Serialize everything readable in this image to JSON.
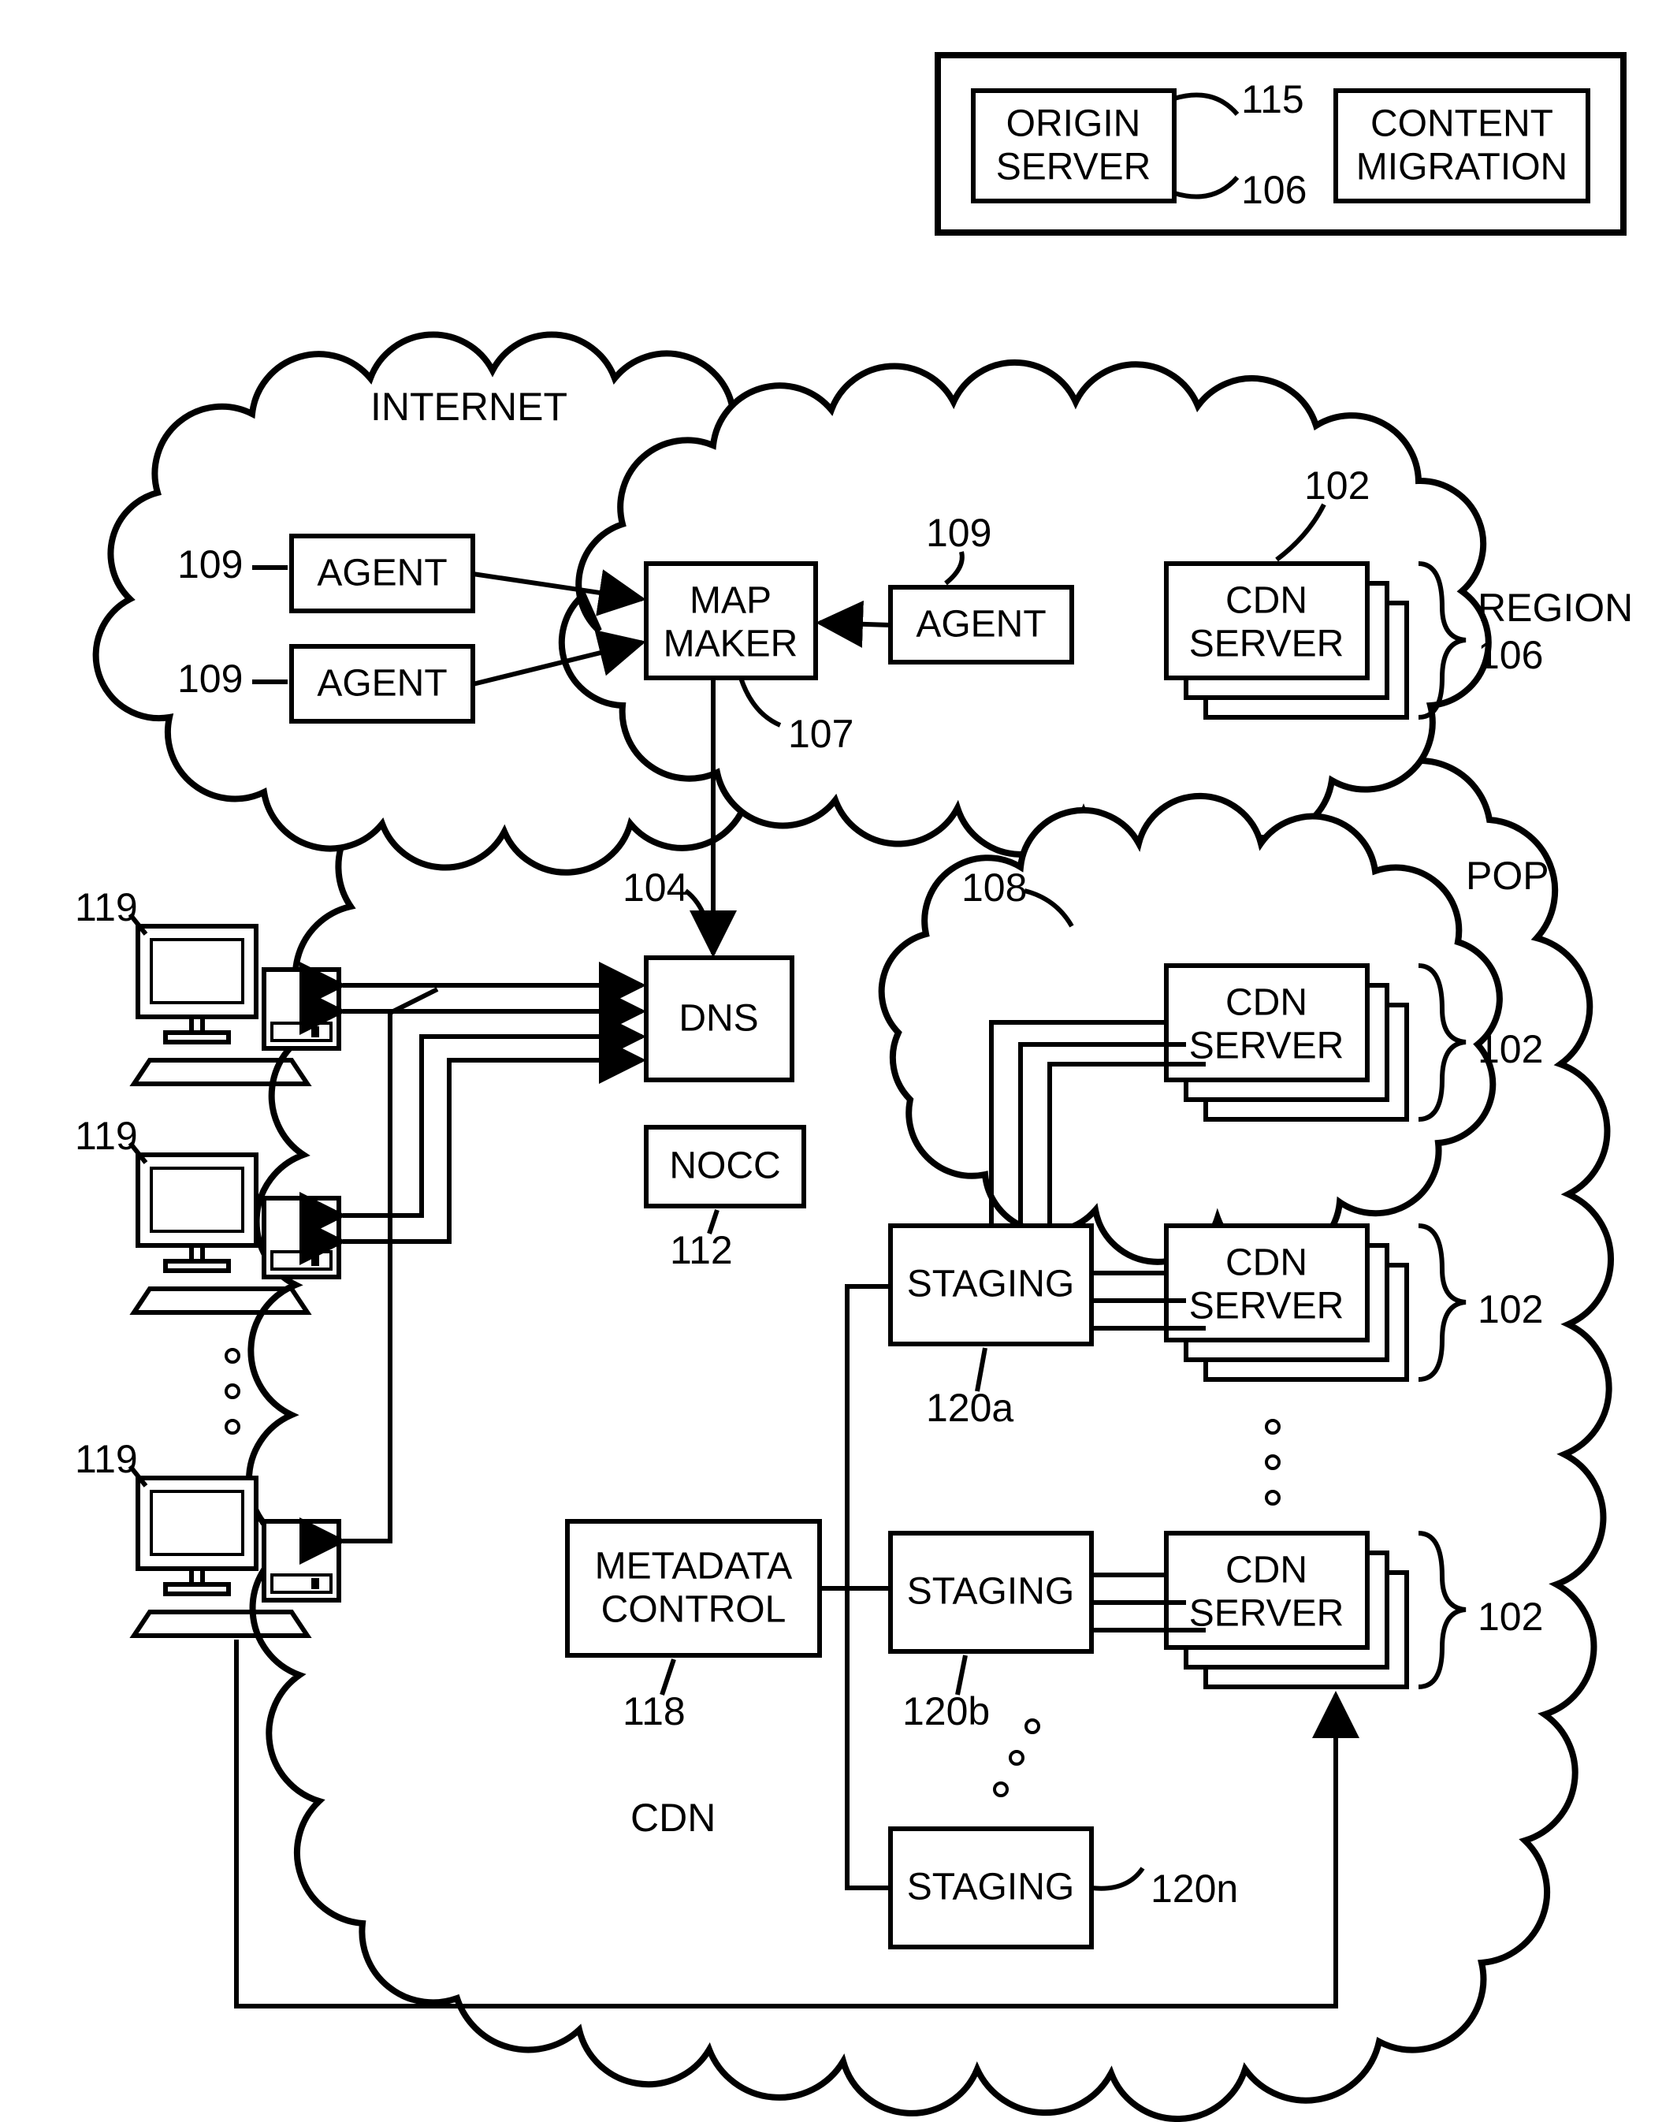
{
  "legend": {
    "originServer": {
      "line1": "ORIGIN",
      "line2": "SERVER",
      "ref": "115"
    },
    "contentMigration": {
      "line1": "CONTENT",
      "line2": "MIGRATION",
      "ref": "106"
    }
  },
  "topLabel": "INTERNET",
  "nodes": {
    "agent1": {
      "label": "AGENT",
      "ref": "109"
    },
    "agent2": {
      "label": "AGENT",
      "ref": "109"
    },
    "agent3": {
      "label": "AGENT",
      "ref": "109"
    },
    "mapMaker": {
      "line1": "MAP",
      "line2": "MAKER",
      "ref": "107",
      "refAbove": "104"
    },
    "cdnServerTop": {
      "line1": "CDN",
      "line2": "SERVER",
      "ref": "102"
    },
    "region": {
      "label": "REGION",
      "ref": "106"
    },
    "dns": {
      "label": "DNS"
    },
    "nocc": {
      "label": "NOCC",
      "ref": "112"
    },
    "pop": {
      "label": "POP",
      "ref": "108"
    },
    "cdnServerPop": {
      "line1": "CDN",
      "line2": "SERVER",
      "ref": "102"
    },
    "cdnServerMid": {
      "line1": "CDN",
      "line2": "SERVER",
      "ref": "102"
    },
    "cdnServerLow": {
      "line1": "CDN",
      "line2": "SERVER",
      "ref": "102"
    },
    "staging1": {
      "label": "STAGING",
      "ref": "120a"
    },
    "staging2": {
      "label": "STAGING",
      "ref": "120b"
    },
    "staging3": {
      "label": "STAGING",
      "ref": "120n"
    },
    "metadata": {
      "line1": "METADATA",
      "line2": "CONTROL",
      "ref": "118"
    },
    "cdn": "CDN",
    "client": {
      "ref": "119"
    }
  }
}
